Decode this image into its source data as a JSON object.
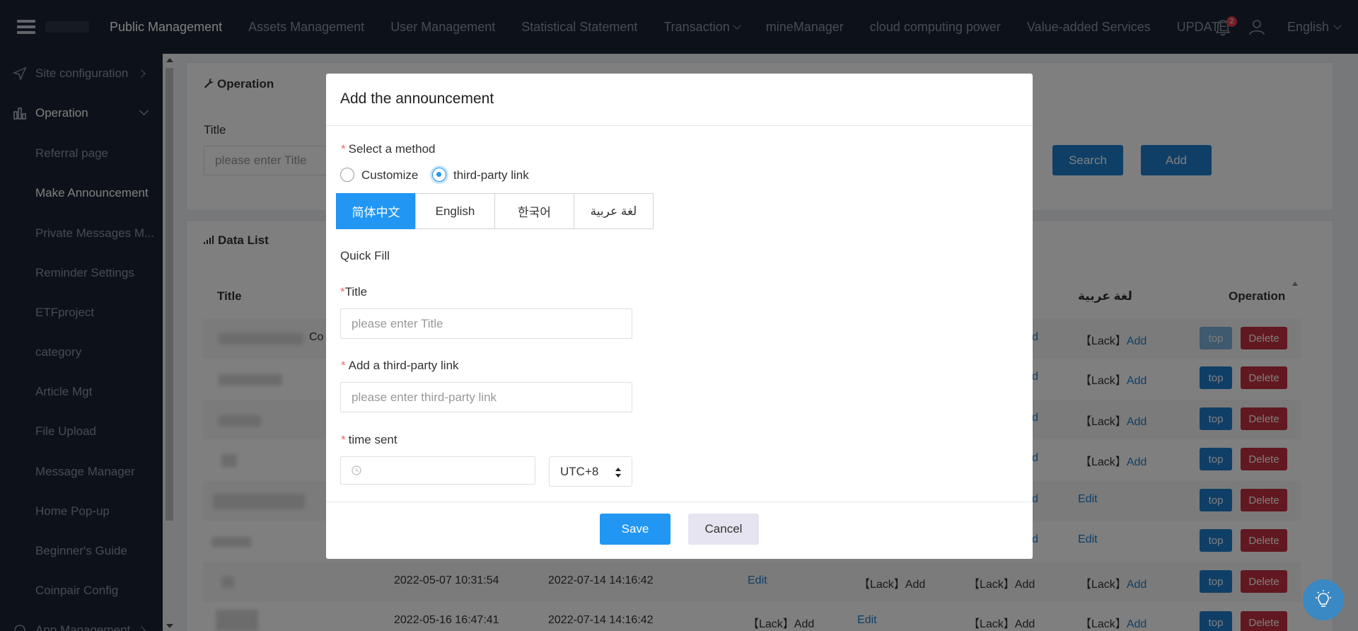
{
  "nav": {
    "items": [
      {
        "label": "Public Management",
        "active": true
      },
      {
        "label": "Assets Management"
      },
      {
        "label": "User Management"
      },
      {
        "label": "Statistical Statement"
      },
      {
        "label": "Transaction",
        "dropdown": true
      },
      {
        "label": "mineManager"
      },
      {
        "label": "cloud computing power"
      },
      {
        "label": "Value-added Services"
      },
      {
        "label": "UPDATE"
      }
    ],
    "notification_count": "2",
    "language": "English"
  },
  "sidebar": {
    "site_config": "Site configuration",
    "operation": "Operation",
    "items": [
      "Referral page",
      "Make Announcement",
      "Private Messages M...",
      "Reminder Settings",
      "ETFproject",
      "category",
      "Article Mgt",
      "File Upload",
      "Message Manager",
      "Home Pop-up",
      "Beginner's Guide",
      "Coinpair Config"
    ],
    "app_management": "App Management"
  },
  "search_panel": {
    "title": "Operation",
    "title_label": "Title",
    "title_placeholder": "please enter Title",
    "search_button": "Search",
    "add_button": "Add"
  },
  "data_list": {
    "title": "Data List",
    "columns": {
      "title": "Title",
      "arabic": "لغة عربية",
      "operation": "Operation"
    },
    "rows": [
      {
        "fragment": "Co",
        "c1": "",
        "c2": "",
        "c3": "",
        "c4": "",
        "c5": "d",
        "c6": "【Lack】",
        "c6link": "Add"
      },
      {
        "fragment": "",
        "c1": "",
        "c2": "",
        "c3": "",
        "c4": "",
        "c5": "d",
        "c6": "【Lack】",
        "c6link": "Add"
      },
      {
        "fragment": "",
        "c1": "",
        "c2": "",
        "c3": "",
        "c4": "",
        "c5": "d",
        "c6": "【Lack】",
        "c6link": "Add"
      },
      {
        "fragment": "",
        "c1": "",
        "c2": "",
        "c3": "",
        "c4": "",
        "c5": "d",
        "c6": "【Lack】",
        "c6link": "Add"
      },
      {
        "fragment": "",
        "c1": "",
        "c2": "",
        "c3": "",
        "c4": "",
        "c5": "d",
        "c6": "",
        "c6link": "Edit"
      },
      {
        "fragment": "",
        "c1": "",
        "c2": "",
        "c3": "",
        "c4": "",
        "c5": "d",
        "c6": "",
        "c6link": "Edit"
      },
      {
        "fragment": "",
        "c1": "2022-05-07 10:31:54",
        "c2": "2022-07-14 14:16:42",
        "c3": "Edit",
        "c4": "【Lack】Add",
        "c5": "【Lack】Add",
        "c6": "【Lack】",
        "c6link": "Add"
      },
      {
        "fragment": "",
        "c1": "2022-05-16 16:47:41",
        "c2": "2022-07-14 14:16:42",
        "c3": "【Lack】Add",
        "c4": "Edit",
        "c5": "【Lack】Add",
        "c6": "【Lack】",
        "c6link": "Add"
      }
    ],
    "top_label": "top",
    "delete_label": "Delete"
  },
  "modal": {
    "title": "Add the announcement",
    "method_label": "Select a method",
    "method_options": [
      "Customize",
      "third-party link"
    ],
    "method_selected": "third-party link",
    "tabs": [
      "简体中文",
      "English",
      "한국어",
      "لغة عربية"
    ],
    "active_tab": "简体中文",
    "quick_fill": "Quick Fill",
    "title_label": "Title",
    "title_placeholder": "please enter Title",
    "link_label": "Add a third-party link",
    "link_placeholder": "please enter third-party link",
    "time_label": "time sent",
    "timezone": "UTC+8",
    "save": "Save",
    "cancel": "Cancel"
  }
}
